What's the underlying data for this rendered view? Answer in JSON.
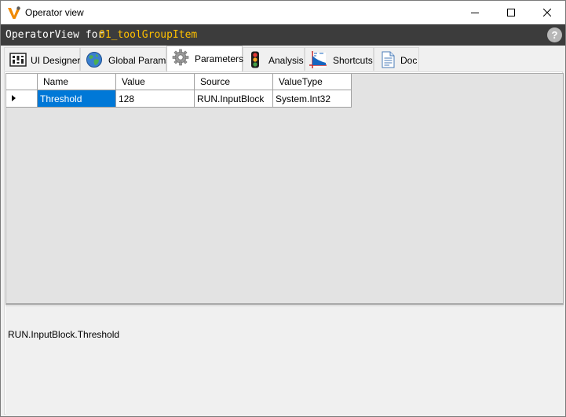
{
  "window": {
    "title": "Operator view",
    "icon": "app-logo-icon",
    "controls": [
      "minimize-icon",
      "maximize-icon",
      "close-icon"
    ]
  },
  "header": {
    "prefix": "OperatorView for",
    "item_name": "01_toolGroupItem",
    "item_color": "#ffc000",
    "help_glyph": "?"
  },
  "tabs": [
    {
      "label": "UI Designer",
      "icon": "ui-designer-icon"
    },
    {
      "label": "Global Params",
      "icon": "globe-icon"
    },
    {
      "label": "Parameters",
      "icon": "gear-icon",
      "active": true
    },
    {
      "label": "Analysis",
      "icon": "traffic-light-icon"
    },
    {
      "label": "Shortcuts",
      "icon": "chart-icon"
    },
    {
      "label": "Doc",
      "icon": "document-icon"
    }
  ],
  "grid": {
    "columns": [
      "Name",
      "Value",
      "Source",
      "ValueType"
    ],
    "rows": [
      {
        "name": "Threshold",
        "value": "128",
        "source": "RUN.InputBlock",
        "value_type": "System.Int32"
      }
    ],
    "selection_color": "#0078d7"
  },
  "detail": {
    "path": "RUN.InputBlock.Threshold"
  }
}
